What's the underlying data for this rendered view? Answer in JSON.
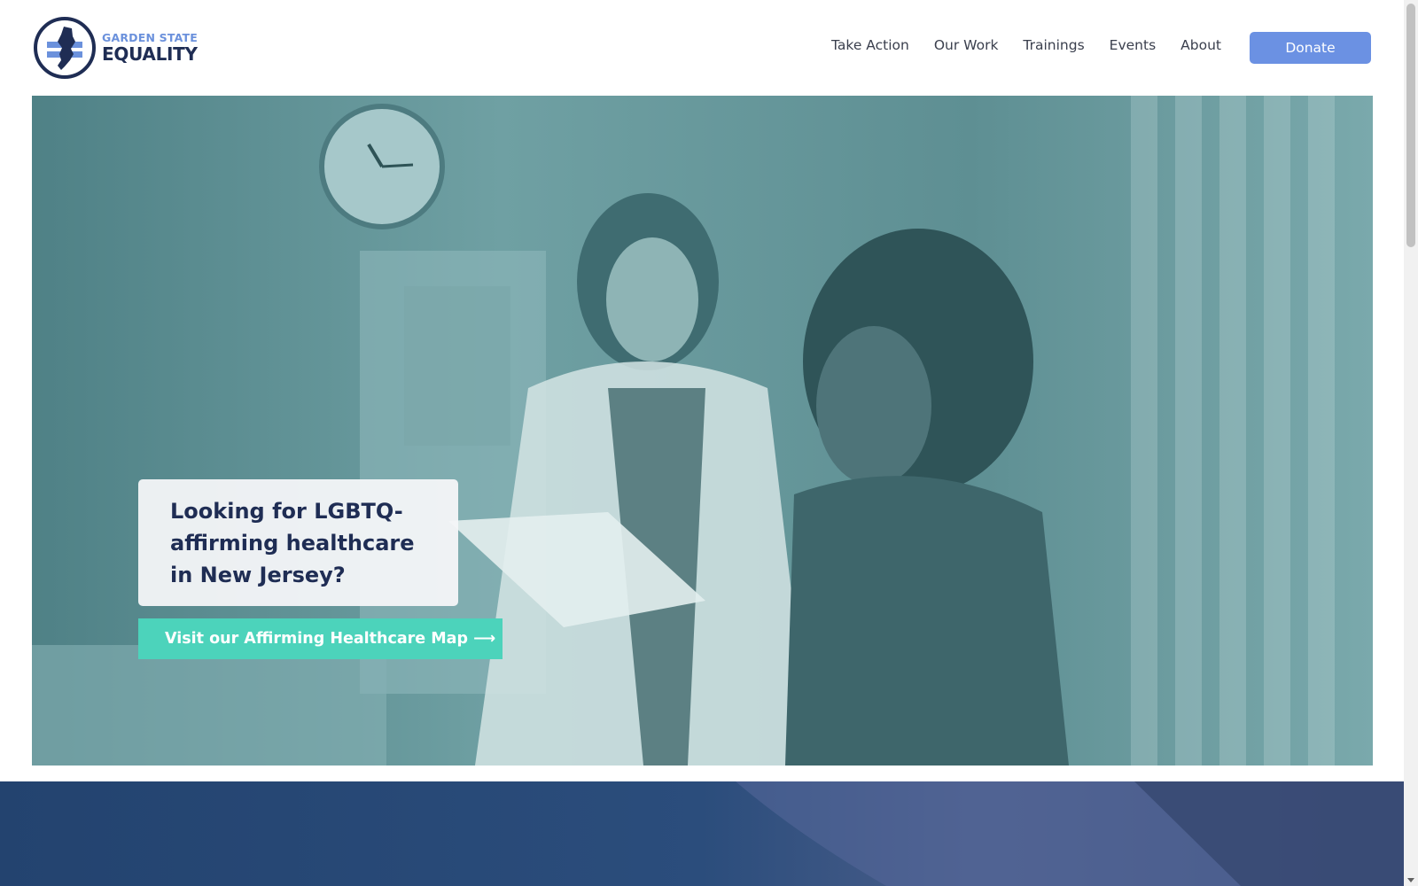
{
  "header": {
    "logo": {
      "line1": "GARDEN STATE",
      "line2": "EQUALITY"
    },
    "nav": [
      {
        "label": "Take Action"
      },
      {
        "label": "Our Work"
      },
      {
        "label": "Trainings"
      },
      {
        "label": "Events"
      },
      {
        "label": "About"
      }
    ],
    "donate_label": "Donate"
  },
  "hero": {
    "card_text": "Looking for LGBTQ-affirming healthcare in New Jersey?",
    "cta_label": "Visit our Affirming Healthcare Map ⟶",
    "colors": {
      "overlay": "#5b8c90",
      "cta": "#4cd3bb",
      "card_text": "#1f2d54"
    }
  },
  "colors": {
    "brand_dark": "#1f2d54",
    "brand_light": "#6b91dc",
    "donate": "#6b91e3",
    "section2": "#2c4f7e"
  }
}
